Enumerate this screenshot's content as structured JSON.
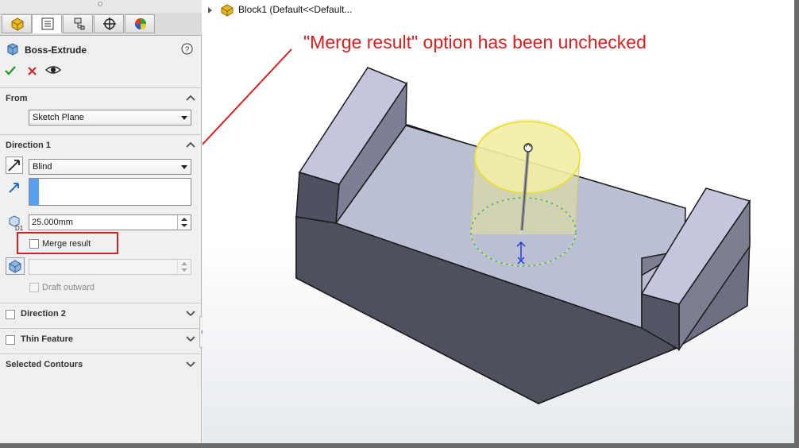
{
  "feature": {
    "title": "Boss-Extrude",
    "help_icon": "question-circle-icon"
  },
  "actions": {
    "ok": "check-icon",
    "cancel": "x-icon",
    "preview": "eye-icon"
  },
  "tabs": [
    "feature-manager-icon",
    "property-manager-icon",
    "configuration-manager-icon",
    "dimxpert-icon",
    "display-manager-icon"
  ],
  "from": {
    "header": "From",
    "value": "Sketch Plane"
  },
  "direction1": {
    "header": "Direction 1",
    "end_condition": "Blind",
    "depth": "25.000mm",
    "merge_label": "Merge result",
    "draft_label": "Draft outward",
    "merge_checked": false
  },
  "direction2": {
    "header": "Direction 2"
  },
  "thin": {
    "header": "Thin Feature"
  },
  "contours": {
    "header": "Selected Contours"
  },
  "tree": {
    "node": "Block1  (Default<<Default..."
  },
  "annotation": "\"Merge result\" option has been unchecked",
  "colors": {
    "annotation": "#d42020",
    "highlight_box": "#d42020",
    "face_light": "#bcc0d6",
    "face_dark": "#50525e"
  }
}
